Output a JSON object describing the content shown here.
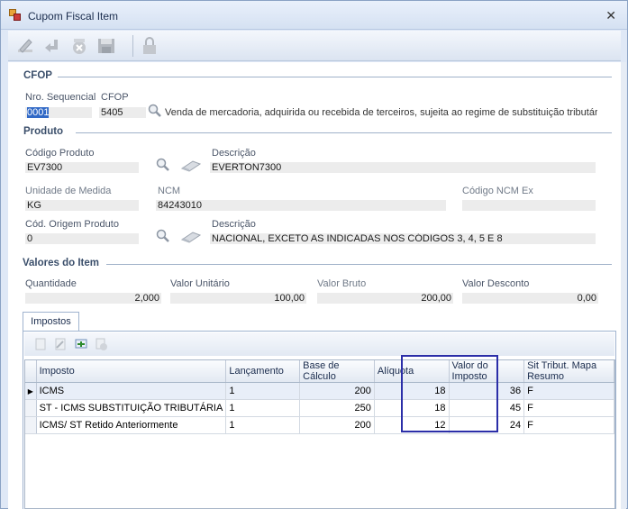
{
  "window": {
    "title": "Cupom Fiscal Item"
  },
  "toolbar": {
    "buttons": [
      "edit-icon",
      "undo-icon",
      "delete-icon",
      "save-icon",
      "lock-icon"
    ]
  },
  "cfop": {
    "section_title": "CFOP",
    "nro_label": "Nro. Sequencial",
    "nro_value": "0001",
    "cfop_label": "CFOP",
    "cfop_value": "5405",
    "description": "Venda de mercadoria, adquirida ou recebida de terceiros, sujeita ao regime de substituição tributária, r"
  },
  "produto": {
    "section_title": "Produto",
    "codigo_label": "Código Produto",
    "codigo_value": "EV7300",
    "descricao_label": "Descrição",
    "descricao_value": "EVERTON7300",
    "unidade_label": "Unidade de Medida",
    "unidade_value": "KG",
    "ncm_label": "NCM",
    "ncm_value": "84243010",
    "ncm_ex_label": "Código NCM Ex",
    "ncm_ex_value": "",
    "origem_label": "Cód. Origem Produto",
    "origem_value": "0",
    "origem_desc_label": "Descrição",
    "origem_desc_value": "NACIONAL, EXCETO AS INDICADAS NOS CÓDIGOS 3, 4, 5 E 8"
  },
  "valores": {
    "section_title": "Valores do Item",
    "quantidade_label": "Quantidade",
    "quantidade_value": "2,000",
    "unitario_label": "Valor Unitário",
    "unitario_value": "100,00",
    "bruto_label": "Valor Bruto",
    "bruto_value": "200,00",
    "desconto_label": "Valor Desconto",
    "desconto_value": "0,00"
  },
  "tabs": {
    "impostos": "Impostos"
  },
  "grid": {
    "columns": [
      "Imposto",
      "Lançamento",
      "Base de Cálculo",
      "Alíquota",
      "Valor do Imposto",
      "Sit Tribut. Mapa Resumo"
    ],
    "rows": [
      {
        "imposto": "ICMS",
        "lancamento": "1",
        "base": "200",
        "aliquota": "18",
        "valor": "36",
        "sit": "F"
      },
      {
        "imposto": "ST - ICMS SUBSTITUIÇÃO TRIBUTÁRIA",
        "lancamento": "1",
        "base": "250",
        "aliquota": "18",
        "valor": "45",
        "sit": "F"
      },
      {
        "imposto": "ICMS/ ST Retido Anteriormente",
        "lancamento": "1",
        "base": "200",
        "aliquota": "12",
        "valor": "24",
        "sit": "F"
      }
    ],
    "row_indicator": "▶"
  },
  "colors": {
    "highlight": "#2b2ea8",
    "selection": "#3169c6",
    "section": "#3b4f6b"
  }
}
